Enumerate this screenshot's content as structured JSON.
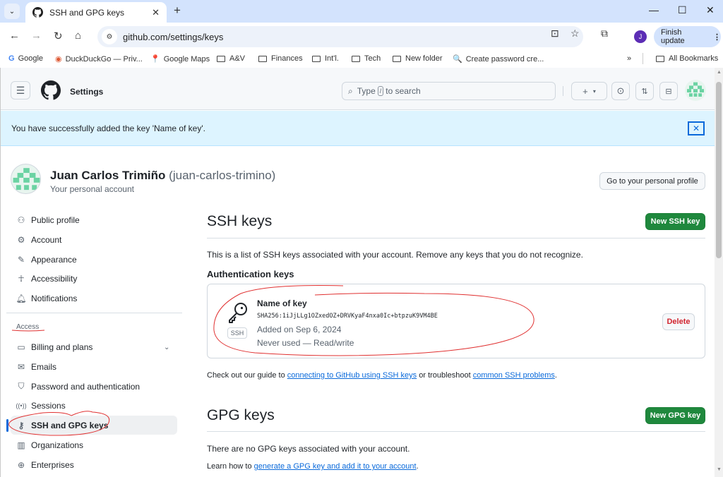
{
  "browser": {
    "tab": {
      "title": "SSH and GPG keys"
    },
    "url": "github.com/settings/keys",
    "profile_initial": "J",
    "update_label": "Finish update",
    "bookmarks": [
      {
        "label": "Google",
        "icon": "google-icon"
      },
      {
        "label": "DuckDuckGo — Priv...",
        "icon": "duckduckgo-icon"
      },
      {
        "label": "Google Maps",
        "icon": "maps-pin-icon"
      },
      {
        "label": "A&V",
        "icon": "folder-icon"
      },
      {
        "label": "Finances",
        "icon": "folder-icon"
      },
      {
        "label": "Int'l.",
        "icon": "folder-icon"
      },
      {
        "label": "Tech",
        "icon": "folder-icon"
      },
      {
        "label": "New folder",
        "icon": "folder-icon"
      },
      {
        "label": "Create password cre...",
        "icon": "key-search-icon"
      }
    ],
    "all_bookmarks": "All Bookmarks"
  },
  "header": {
    "context": "Settings",
    "search_prefix": "Type",
    "search_key": "/",
    "search_suffix": "to search"
  },
  "flash": {
    "message": "You have successfully added the key 'Name of key'.",
    "close": "✕"
  },
  "account": {
    "name": "Juan Carlos Trimiño",
    "login": "(juan-carlos-trimino)",
    "subtitle": "Your personal account",
    "profile_button": "Go to your personal profile"
  },
  "sidebar": {
    "items": [
      {
        "label": "Public profile",
        "icon": "person-icon"
      },
      {
        "label": "Account",
        "icon": "gear-icon"
      },
      {
        "label": "Appearance",
        "icon": "paintbrush-icon"
      },
      {
        "label": "Accessibility",
        "icon": "accessibility-icon"
      },
      {
        "label": "Notifications",
        "icon": "bell-icon"
      }
    ],
    "access_heading": "Access",
    "access_items": [
      {
        "label": "Billing and plans",
        "icon": "credit-card-icon"
      },
      {
        "label": "Emails",
        "icon": "mail-icon"
      },
      {
        "label": "Password and authentication",
        "icon": "shield-lock-icon"
      },
      {
        "label": "Sessions",
        "icon": "broadcast-icon"
      },
      {
        "label": "SSH and GPG keys",
        "icon": "key-icon",
        "active": true
      },
      {
        "label": "Organizations",
        "icon": "organization-icon"
      },
      {
        "label": "Enterprises",
        "icon": "globe-icon"
      }
    ]
  },
  "ssh": {
    "title": "SSH keys",
    "new_button": "New SSH key",
    "description": "This is a list of SSH keys associated with your account. Remove any keys that you do not recognize.",
    "auth_heading": "Authentication keys",
    "keys": [
      {
        "name": "Name of key",
        "fingerprint": "SHA256:1iJjLLg1OZxedOZ+DRVKyaF4nxa0Ic+btpzuK9VM4BE",
        "added": "Added on Sep 6, 2024",
        "usage": "Never used — Read/write",
        "badge": "SSH",
        "delete_label": "Delete"
      }
    ],
    "guide_prefix": "Check out our guide to",
    "guide_link": "connecting to GitHub using SSH keys",
    "guide_middle": "or troubleshoot",
    "guide_link2": "common SSH problems",
    "guide_suffix": "."
  },
  "gpg": {
    "title": "GPG keys",
    "new_button": "New GPG key",
    "empty": "There are no GPG keys associated with your account.",
    "learn_prefix": "Learn how to",
    "learn_link": "generate a GPG key and add it to your account",
    "learn_suffix": "."
  },
  "colors": {
    "accent": "#0969da",
    "primary_button": "#1f883d",
    "danger": "#d1242f",
    "flash_bg": "#ddf4ff",
    "annotation": "#e03030"
  }
}
